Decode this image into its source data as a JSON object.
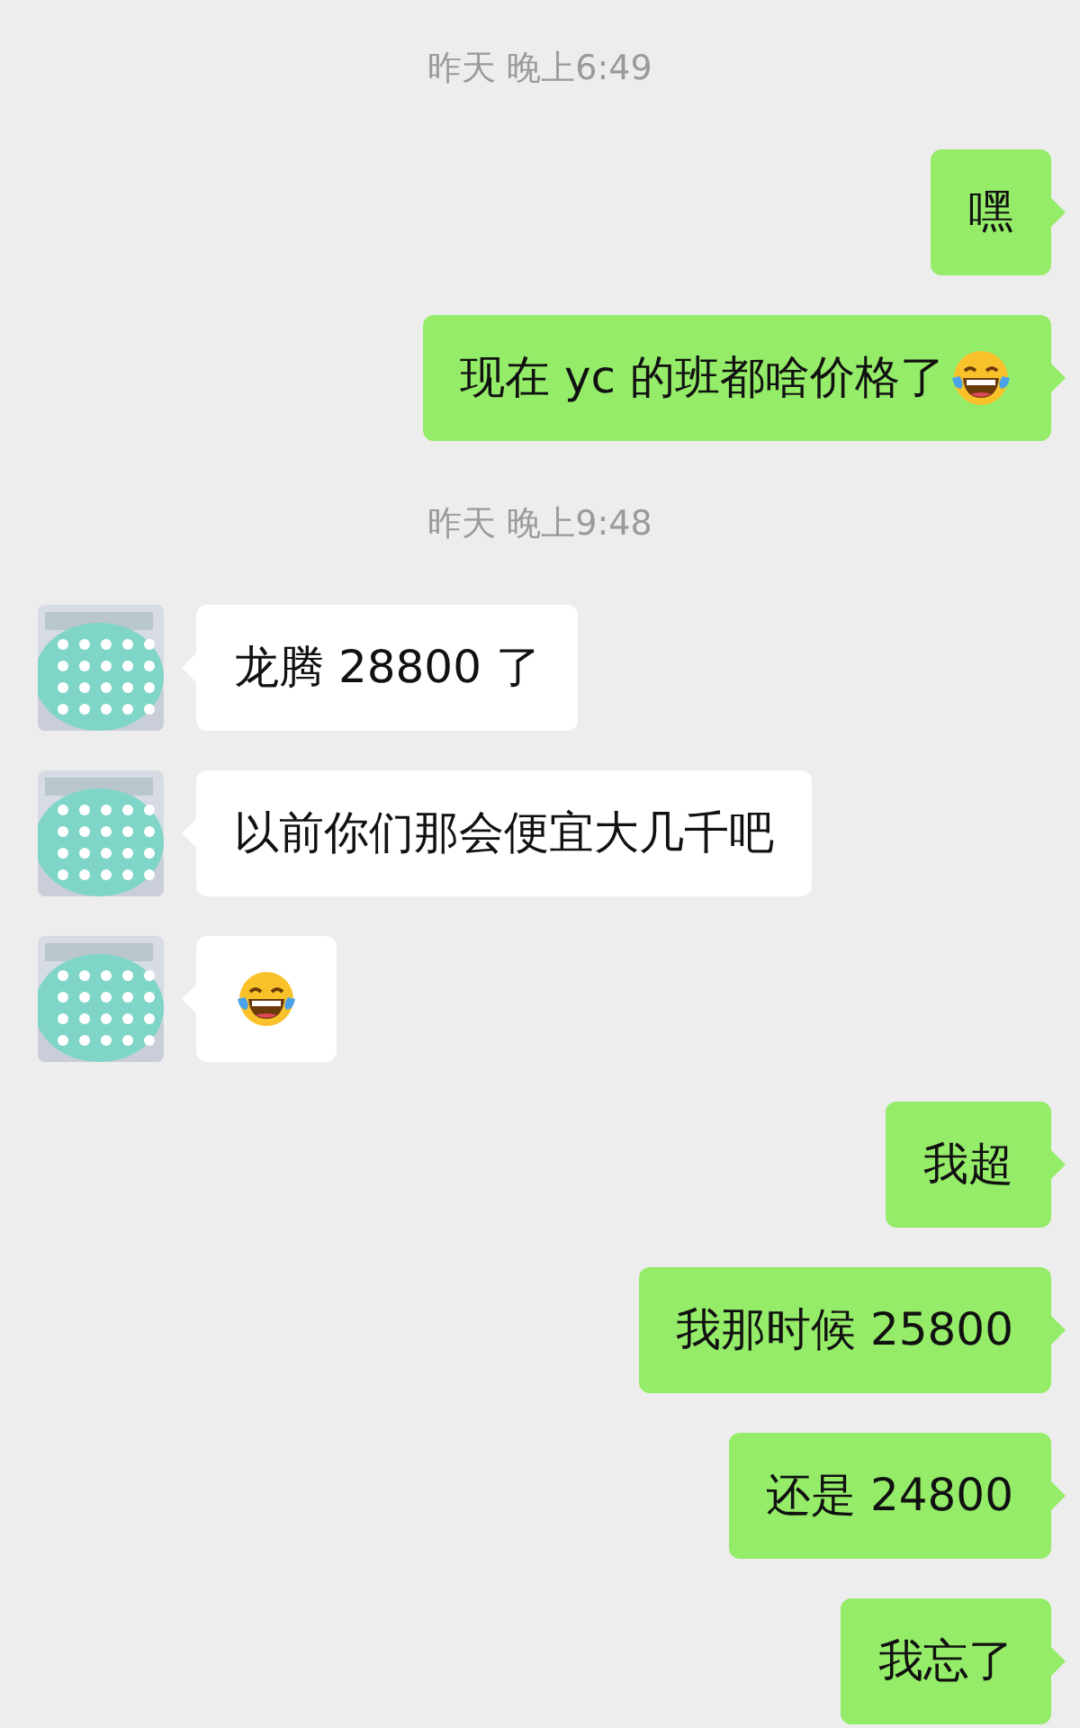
{
  "messages": [
    {
      "kind": "time",
      "text": "昨天 晚上6:49"
    },
    {
      "kind": "text",
      "sent": true,
      "text": "嘿",
      "trailing_emoji": false
    },
    {
      "kind": "text",
      "sent": true,
      "text": "现在 yc 的班都啥价格了",
      "trailing_emoji": true
    },
    {
      "kind": "time",
      "text": "昨天 晚上9:48"
    },
    {
      "kind": "text",
      "sent": false,
      "text": "龙腾 28800 了",
      "trailing_emoji": false
    },
    {
      "kind": "text",
      "sent": false,
      "text": "以前你们那会便宜大几千吧",
      "trailing_emoji": false
    },
    {
      "kind": "emoji",
      "sent": false
    },
    {
      "kind": "text",
      "sent": true,
      "text": "我超",
      "trailing_emoji": false
    },
    {
      "kind": "text",
      "sent": true,
      "text": "我那时候 25800",
      "trailing_emoji": false
    },
    {
      "kind": "text",
      "sent": true,
      "text": "还是 24800",
      "trailing_emoji": false
    },
    {
      "kind": "text",
      "sent": true,
      "text": "我忘了",
      "trailing_emoji": false
    }
  ]
}
